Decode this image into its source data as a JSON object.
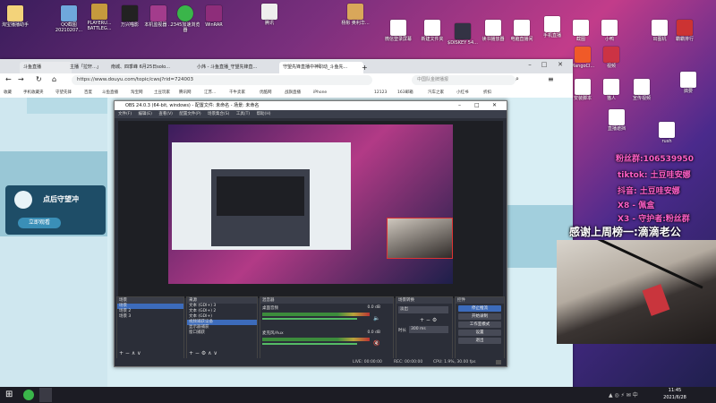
{
  "desktop_icons": [
    {
      "label": "淘宝播播助手"
    },
    {
      "label": "QQ截图 20210207..."
    },
    {
      "label": "PLAYERU... BATTLEG..."
    },
    {
      "label": "万兴喵影"
    },
    {
      "label": "本机监视器 ..."
    },
    {
      "label": "2345加速浏览器"
    },
    {
      "label": "WinRAR"
    },
    {
      "label": "腾讯"
    },
    {
      "label": "杨彬 奥利华..."
    },
    {
      "label": "微信登录屏幕"
    },
    {
      "label": "新建文件夹"
    },
    {
      "label": "$DISKEY 54..."
    },
    {
      "label": "读书播放器"
    },
    {
      "label": "电脑直播间"
    },
    {
      "label": "手机直播"
    },
    {
      "label": "截图"
    },
    {
      "label": "小鸭"
    },
    {
      "label": "出图机"
    },
    {
      "label": "霸霸排行"
    },
    {
      "label": "MangoCl..."
    },
    {
      "label": "视频"
    },
    {
      "label": "安装脚本"
    },
    {
      "label": "猫人"
    },
    {
      "label": "宣传视频"
    },
    {
      "label": "搞要"
    },
    {
      "label": "直播遮挡"
    },
    {
      "label": "rush"
    }
  ],
  "browser": {
    "tabs": [
      {
        "label": "斗鱼直播",
        "active": false
      },
      {
        "label": "主播「拉轩…」",
        "active": false
      },
      {
        "label": "南城、四季峰 6月25日solo...",
        "active": false
      },
      {
        "label": "小炜 - 斗鱼直播_守望先锋直...",
        "active": false
      },
      {
        "label": "守望先锋直播中神职动_斗鱼先...",
        "active": true
      }
    ],
    "new_tab": "+",
    "url": "https://www.douyu.com/topic/cwsj?rid=724003",
    "search_placeholder": "中国队金牌播报",
    "bookmarks": [
      "收藏",
      "手机收藏夹",
      "守望先锋",
      "百度",
      "斗鱼直播",
      "淘宝网",
      "土豆玩家",
      "腾讯网",
      "江苏...",
      "千牛卖家",
      "优酷网",
      "战旗直播",
      "iPhone",
      "12123",
      "163邮箱",
      "汽车之家",
      "小红书",
      "折扣"
    ],
    "page_left_text": "点后守望冲",
    "page_btn": "立即观看"
  },
  "obs": {
    "title": "OBS 24.0.3 (64-bit, windows) - 配置文件: 未命名 - 场景: 未命名",
    "menu": [
      "文件(F)",
      "编辑(E)",
      "查看(V)",
      "配置文件(P)",
      "场景集合(S)",
      "工具(T)",
      "帮助(H)"
    ],
    "panels": {
      "scenes": {
        "header": "场景",
        "items": [
          "场景",
          "场景 2",
          "场景 3"
        ]
      },
      "sources": {
        "header": "来源",
        "items": [
          "文本 (GDI+) 3",
          "文本 (GDI+) 2",
          "文本 (GDI+)",
          "视频捕获设备",
          "显示器捕获",
          "窗口捕获"
        ]
      },
      "mixer": {
        "header": "混音器",
        "tracks": [
          {
            "name": "桌面音频",
            "db": "0.0 dB"
          },
          {
            "name": "麦克风/Aux",
            "db": "0.0 dB"
          }
        ]
      },
      "transitions": {
        "header": "场景转换",
        "type": "淡出",
        "duration_label": "时长",
        "duration": "300 ms"
      },
      "controls": {
        "header": "控件",
        "buttons": [
          "停止推流",
          "开始录制",
          "工作室模式",
          "设置",
          "退出"
        ]
      }
    },
    "status": {
      "live": "LIVE: 00:00:00",
      "rec": "REC: 00:00:00",
      "cpu": "CPU: 1.9%, 30.00 fps"
    }
  },
  "overlay": {
    "fans": "粉丝群:106539950",
    "tiktok": "tiktok: 土豆哇安娜",
    "douyin": "抖音: 土豆哇安娜",
    "x8": "X8 - 佩盒",
    "x3": "X3 - 守护者:粉丝群",
    "thanks": "感谢上周榜一:滴滴老公"
  },
  "taskbar": {
    "time": "11:45",
    "date": "2021/6/28"
  },
  "colors": {
    "obs_bg": "#2b2e38",
    "accent": "#3c6bbb",
    "overlay_text": "#ff3fbf"
  }
}
